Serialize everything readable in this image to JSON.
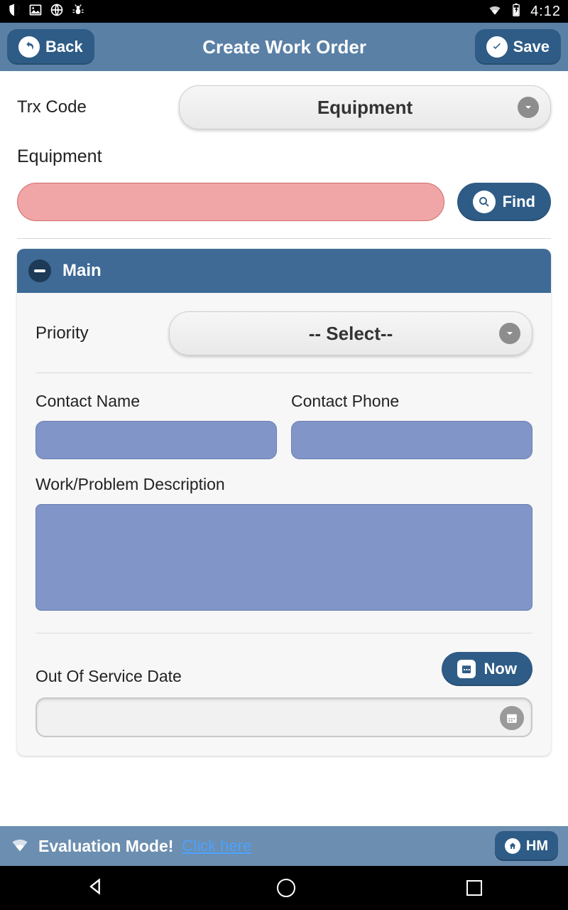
{
  "statusbar": {
    "time": "4:12"
  },
  "header": {
    "back": "Back",
    "title": "Create Work Order",
    "save": "Save"
  },
  "trx": {
    "label": "Trx Code",
    "value": "Equipment"
  },
  "equipment": {
    "label": "Equipment",
    "find": "Find"
  },
  "section": {
    "title": "Main",
    "priority": {
      "label": "Priority",
      "value": "-- Select--"
    },
    "contactName": {
      "label": "Contact Name"
    },
    "contactPhone": {
      "label": "Contact Phone"
    },
    "description": {
      "label": "Work/Problem Description"
    },
    "outOfService": {
      "label": "Out Of Service Date",
      "now": "Now"
    }
  },
  "evalbar": {
    "text": "Evaluation Mode!",
    "link": "Click here",
    "hm": "HM"
  }
}
